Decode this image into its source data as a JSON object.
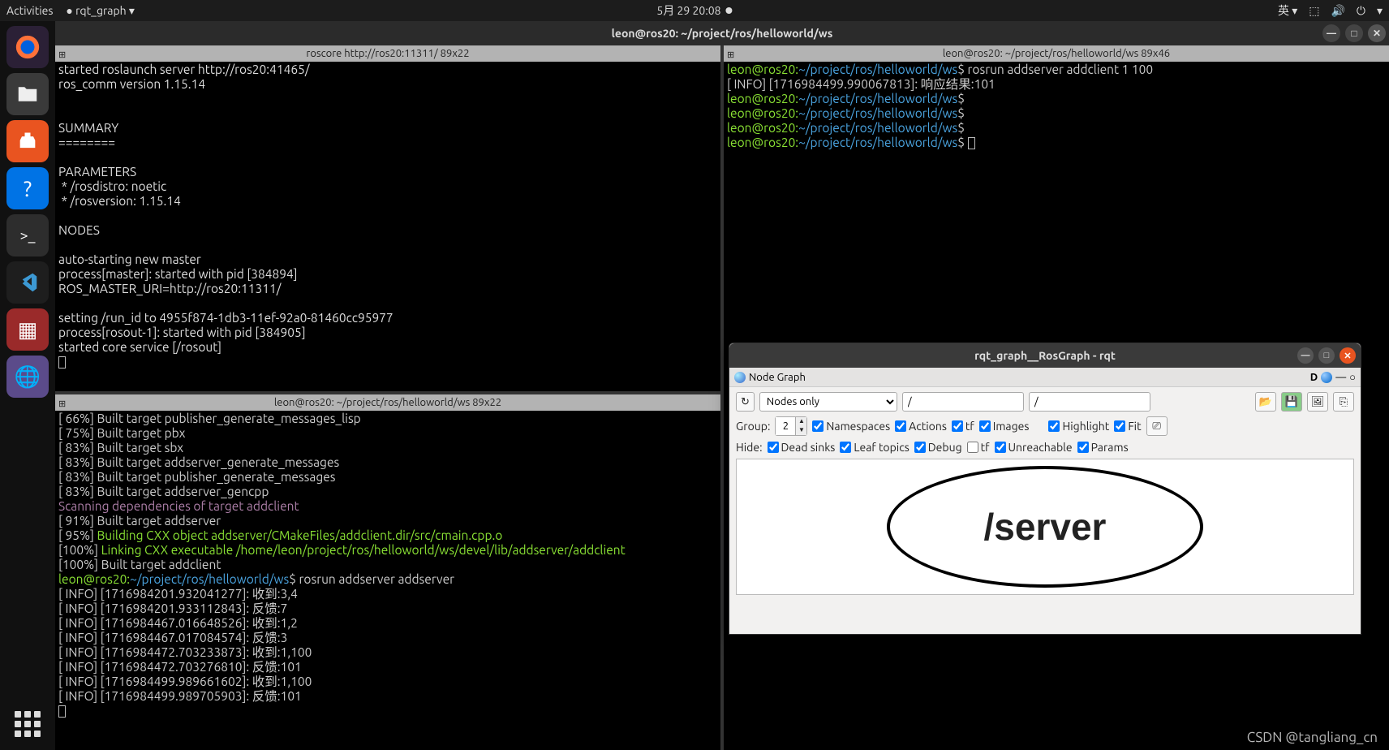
{
  "topbar": {
    "activities": "Activities",
    "app": "rqt_graph ▾",
    "datetime": "5月 29  20:08",
    "ime": "英 ▾"
  },
  "gnome": {
    "title": "leon@ros20: ~/project/ros/helloworld/ws"
  },
  "pane_tl": {
    "title": "roscore http://ros20:11311/ 89x22",
    "lines": [
      {
        "c": "w",
        "t": "started roslaunch server http://ros20:41465/"
      },
      {
        "c": "w",
        "t": "ros_comm version 1.15.14"
      },
      {
        "c": "w",
        "t": ""
      },
      {
        "c": "w",
        "t": ""
      },
      {
        "c": "w",
        "t": "SUMMARY"
      },
      {
        "c": "w",
        "t": "========"
      },
      {
        "c": "w",
        "t": ""
      },
      {
        "c": "w",
        "t": "PARAMETERS"
      },
      {
        "c": "w",
        "t": " * /rosdistro: noetic"
      },
      {
        "c": "w",
        "t": " * /rosversion: 1.15.14"
      },
      {
        "c": "w",
        "t": ""
      },
      {
        "c": "w",
        "t": "NODES"
      },
      {
        "c": "w",
        "t": ""
      },
      {
        "c": "w",
        "t": "auto-starting new master"
      },
      {
        "c": "w",
        "t": "process[master]: started with pid [384894]"
      },
      {
        "c": "w",
        "t": "ROS_MASTER_URI=http://ros20:11311/"
      },
      {
        "c": "w",
        "t": ""
      },
      {
        "c": "w",
        "t": "setting /run_id to 4955f874-1db3-11ef-92a0-81460cc95977"
      },
      {
        "c": "w",
        "t": "process[rosout-1]: started with pid [384905]"
      },
      {
        "c": "w",
        "t": "started core service [/rosout]"
      }
    ]
  },
  "pane_bl": {
    "title": "leon@ros20: ~/project/ros/helloworld/ws 89x22",
    "build": [
      "[ 66%] Built target publisher_generate_messages_lisp",
      "[ 75%] Built target pbx",
      "[ 83%] Built target sbx",
      "[ 83%] Built target addserver_generate_messages",
      "[ 83%] Built target publisher_generate_messages",
      "[ 83%] Built target addserver_gencpp"
    ],
    "scan": "Scanning dependencies of target addclient",
    "b91": "[ 91%] Built target addserver",
    "b95_pre": "[ 95%] ",
    "b95_g": "Building CXX object addserver/CMakeFiles/addclient.dir/src/cmain.cpp.o",
    "b100_pre": "[100%] ",
    "b100_g": "Linking CXX executable /home/leon/project/ros/helloworld/ws/devel/lib/addserver/addclient",
    "b100_built": "[100%] Built target addclient",
    "prompt_user": "leon@ros20:",
    "prompt_path": "~/project/ros/helloworld/ws",
    "prompt_cmd": "$ rosrun addserver addserver",
    "logs": [
      "[ INFO] [1716984201.932041277]: 收到:3,4",
      "[ INFO] [1716984201.933112843]: 反馈:7",
      "[ INFO] [1716984467.016648526]: 收到:1,2",
      "[ INFO] [1716984467.017084574]: 反馈:3",
      "[ INFO] [1716984472.703233873]: 收到:1,100",
      "[ INFO] [1716984472.703276810]: 反馈:101",
      "[ INFO] [1716984499.989661602]: 收到:1,100",
      "[ INFO] [1716984499.989705903]: 反馈:101"
    ]
  },
  "pane_r": {
    "title": "leon@ros20: ~/project/ros/helloworld/ws 89x46",
    "prompt_user": "leon@ros20:",
    "prompt_path": "~/project/ros/helloworld/ws",
    "cmd": "$ rosrun addserver addclient 1 100",
    "info": "[ INFO] [1716984499.990067813]: 响应结果:101",
    "dollar": "$"
  },
  "rqt": {
    "title": "rqt_graph__RosGraph - rqt",
    "tab": "Node Graph",
    "dropdown": "Nodes only",
    "filter1": "/",
    "filter2": "/",
    "group_label": "Group:",
    "group_val": "2",
    "ns": "Namespaces",
    "actions": "Actions",
    "tf": "tf",
    "images": "Images",
    "highlight": "Highlight",
    "fit": "Fit",
    "hide": "Hide:",
    "deadsinks": "Dead sinks",
    "leaf": "Leaf topics",
    "debug": "Debug",
    "tf2": "tf",
    "unreach": "Unreachable",
    "params": "Params",
    "node": "/server"
  },
  "watermark": "CSDN @tangliang_cn"
}
